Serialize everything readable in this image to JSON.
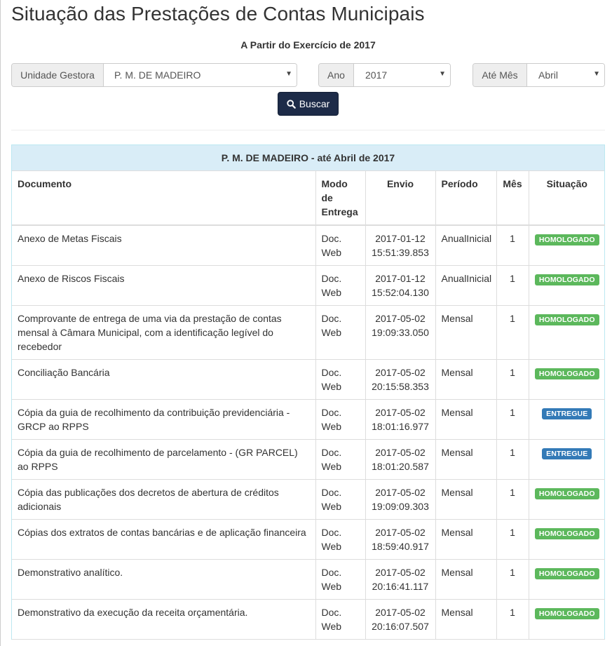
{
  "page": {
    "title": "Situação das Prestações de Contas Municipais",
    "subtitle": "A Partir do Exercício de 2017"
  },
  "filters": {
    "unidade_label": "Unidade Gestora",
    "unidade_value": "P. M. DE MADEIRO",
    "ano_label": "Ano",
    "ano_value": "2017",
    "mes_label": "Até Mês",
    "mes_value": "Abril",
    "search_button": "Buscar"
  },
  "colors": {
    "homologado": "#5cb85c",
    "entregue": "#337ab7",
    "button": "#1d2b48",
    "panel_heading": "#d9edf7"
  },
  "panel": {
    "heading": "P. M. DE MADEIRO - até Abril de 2017"
  },
  "table": {
    "headers": {
      "documento": "Documento",
      "modo": "Modo de Entrega",
      "envio": "Envio",
      "periodo": "Período",
      "mes": "Mês",
      "situacao": "Situação"
    },
    "rows": [
      {
        "documento": "Anexo de Metas Fiscais",
        "modo": "Doc. Web",
        "envio_date": "2017-01-12",
        "envio_time": "15:51:39.853",
        "periodo": "AnualInicial",
        "mes": "1",
        "situacao": "HOMOLOGADO"
      },
      {
        "documento": "Anexo de Riscos Fiscais",
        "modo": "Doc. Web",
        "envio_date": "2017-01-12",
        "envio_time": "15:52:04.130",
        "periodo": "AnualInicial",
        "mes": "1",
        "situacao": "HOMOLOGADO"
      },
      {
        "documento": "Comprovante de entrega de uma via da prestação de contas mensal à Câmara Municipal, com a identificação legível do recebedor",
        "modo": "Doc. Web",
        "envio_date": "2017-05-02",
        "envio_time": "19:09:33.050",
        "periodo": "Mensal",
        "mes": "1",
        "situacao": "HOMOLOGADO"
      },
      {
        "documento": "Conciliação Bancária",
        "modo": "Doc. Web",
        "envio_date": "2017-05-02",
        "envio_time": "20:15:58.353",
        "periodo": "Mensal",
        "mes": "1",
        "situacao": "HOMOLOGADO"
      },
      {
        "documento": "Cópia da guia de recolhimento da contribuição previdenciária - GRCP ao RPPS",
        "modo": "Doc. Web",
        "envio_date": "2017-05-02",
        "envio_time": "18:01:16.977",
        "periodo": "Mensal",
        "mes": "1",
        "situacao": "ENTREGUE"
      },
      {
        "documento": "Cópia da guia de recolhimento de parcelamento - (GR PARCEL) ao RPPS",
        "modo": "Doc. Web",
        "envio_date": "2017-05-02",
        "envio_time": "18:01:20.587",
        "periodo": "Mensal",
        "mes": "1",
        "situacao": "ENTREGUE"
      },
      {
        "documento": "Cópia das publicações dos decretos de abertura de créditos adicionais",
        "modo": "Doc. Web",
        "envio_date": "2017-05-02",
        "envio_time": "19:09:09.303",
        "periodo": "Mensal",
        "mes": "1",
        "situacao": "HOMOLOGADO"
      },
      {
        "documento": "Cópias dos extratos de contas bancárias e de aplicação financeira",
        "modo": "Doc. Web",
        "envio_date": "2017-05-02",
        "envio_time": "18:59:40.917",
        "periodo": "Mensal",
        "mes": "1",
        "situacao": "HOMOLOGADO"
      },
      {
        "documento": "Demonstrativo analítico.",
        "modo": "Doc. Web",
        "envio_date": "2017-05-02",
        "envio_time": "20:16:41.117",
        "periodo": "Mensal",
        "mes": "1",
        "situacao": "HOMOLOGADO"
      },
      {
        "documento": "Demonstrativo da execução da receita orçamentária.",
        "modo": "Doc. Web",
        "envio_date": "2017-05-02",
        "envio_time": "20:16:07.507",
        "periodo": "Mensal",
        "mes": "1",
        "situacao": "HOMOLOGADO"
      }
    ]
  }
}
